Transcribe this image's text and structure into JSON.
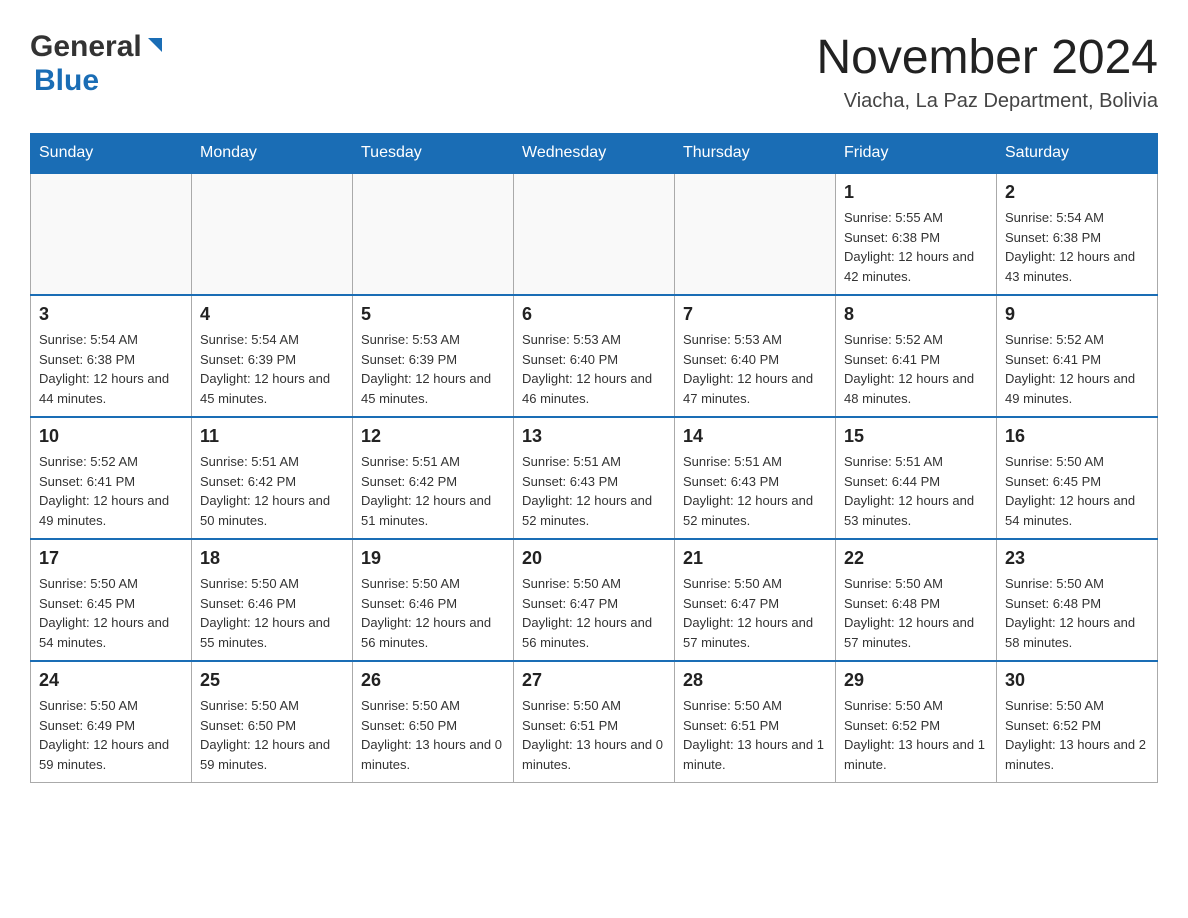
{
  "header": {
    "logo_general": "General",
    "logo_blue": "Blue",
    "month_title": "November 2024",
    "location": "Viacha, La Paz Department, Bolivia"
  },
  "weekdays": [
    "Sunday",
    "Monday",
    "Tuesday",
    "Wednesday",
    "Thursday",
    "Friday",
    "Saturday"
  ],
  "weeks": [
    [
      {
        "day": "",
        "info": ""
      },
      {
        "day": "",
        "info": ""
      },
      {
        "day": "",
        "info": ""
      },
      {
        "day": "",
        "info": ""
      },
      {
        "day": "",
        "info": ""
      },
      {
        "day": "1",
        "info": "Sunrise: 5:55 AM\nSunset: 6:38 PM\nDaylight: 12 hours and 42 minutes."
      },
      {
        "day": "2",
        "info": "Sunrise: 5:54 AM\nSunset: 6:38 PM\nDaylight: 12 hours and 43 minutes."
      }
    ],
    [
      {
        "day": "3",
        "info": "Sunrise: 5:54 AM\nSunset: 6:38 PM\nDaylight: 12 hours and 44 minutes."
      },
      {
        "day": "4",
        "info": "Sunrise: 5:54 AM\nSunset: 6:39 PM\nDaylight: 12 hours and 45 minutes."
      },
      {
        "day": "5",
        "info": "Sunrise: 5:53 AM\nSunset: 6:39 PM\nDaylight: 12 hours and 45 minutes."
      },
      {
        "day": "6",
        "info": "Sunrise: 5:53 AM\nSunset: 6:40 PM\nDaylight: 12 hours and 46 minutes."
      },
      {
        "day": "7",
        "info": "Sunrise: 5:53 AM\nSunset: 6:40 PM\nDaylight: 12 hours and 47 minutes."
      },
      {
        "day": "8",
        "info": "Sunrise: 5:52 AM\nSunset: 6:41 PM\nDaylight: 12 hours and 48 minutes."
      },
      {
        "day": "9",
        "info": "Sunrise: 5:52 AM\nSunset: 6:41 PM\nDaylight: 12 hours and 49 minutes."
      }
    ],
    [
      {
        "day": "10",
        "info": "Sunrise: 5:52 AM\nSunset: 6:41 PM\nDaylight: 12 hours and 49 minutes."
      },
      {
        "day": "11",
        "info": "Sunrise: 5:51 AM\nSunset: 6:42 PM\nDaylight: 12 hours and 50 minutes."
      },
      {
        "day": "12",
        "info": "Sunrise: 5:51 AM\nSunset: 6:42 PM\nDaylight: 12 hours and 51 minutes."
      },
      {
        "day": "13",
        "info": "Sunrise: 5:51 AM\nSunset: 6:43 PM\nDaylight: 12 hours and 52 minutes."
      },
      {
        "day": "14",
        "info": "Sunrise: 5:51 AM\nSunset: 6:43 PM\nDaylight: 12 hours and 52 minutes."
      },
      {
        "day": "15",
        "info": "Sunrise: 5:51 AM\nSunset: 6:44 PM\nDaylight: 12 hours and 53 minutes."
      },
      {
        "day": "16",
        "info": "Sunrise: 5:50 AM\nSunset: 6:45 PM\nDaylight: 12 hours and 54 minutes."
      }
    ],
    [
      {
        "day": "17",
        "info": "Sunrise: 5:50 AM\nSunset: 6:45 PM\nDaylight: 12 hours and 54 minutes."
      },
      {
        "day": "18",
        "info": "Sunrise: 5:50 AM\nSunset: 6:46 PM\nDaylight: 12 hours and 55 minutes."
      },
      {
        "day": "19",
        "info": "Sunrise: 5:50 AM\nSunset: 6:46 PM\nDaylight: 12 hours and 56 minutes."
      },
      {
        "day": "20",
        "info": "Sunrise: 5:50 AM\nSunset: 6:47 PM\nDaylight: 12 hours and 56 minutes."
      },
      {
        "day": "21",
        "info": "Sunrise: 5:50 AM\nSunset: 6:47 PM\nDaylight: 12 hours and 57 minutes."
      },
      {
        "day": "22",
        "info": "Sunrise: 5:50 AM\nSunset: 6:48 PM\nDaylight: 12 hours and 57 minutes."
      },
      {
        "day": "23",
        "info": "Sunrise: 5:50 AM\nSunset: 6:48 PM\nDaylight: 12 hours and 58 minutes."
      }
    ],
    [
      {
        "day": "24",
        "info": "Sunrise: 5:50 AM\nSunset: 6:49 PM\nDaylight: 12 hours and 59 minutes."
      },
      {
        "day": "25",
        "info": "Sunrise: 5:50 AM\nSunset: 6:50 PM\nDaylight: 12 hours and 59 minutes."
      },
      {
        "day": "26",
        "info": "Sunrise: 5:50 AM\nSunset: 6:50 PM\nDaylight: 13 hours and 0 minutes."
      },
      {
        "day": "27",
        "info": "Sunrise: 5:50 AM\nSunset: 6:51 PM\nDaylight: 13 hours and 0 minutes."
      },
      {
        "day": "28",
        "info": "Sunrise: 5:50 AM\nSunset: 6:51 PM\nDaylight: 13 hours and 1 minute."
      },
      {
        "day": "29",
        "info": "Sunrise: 5:50 AM\nSunset: 6:52 PM\nDaylight: 13 hours and 1 minute."
      },
      {
        "day": "30",
        "info": "Sunrise: 5:50 AM\nSunset: 6:52 PM\nDaylight: 13 hours and 2 minutes."
      }
    ]
  ]
}
